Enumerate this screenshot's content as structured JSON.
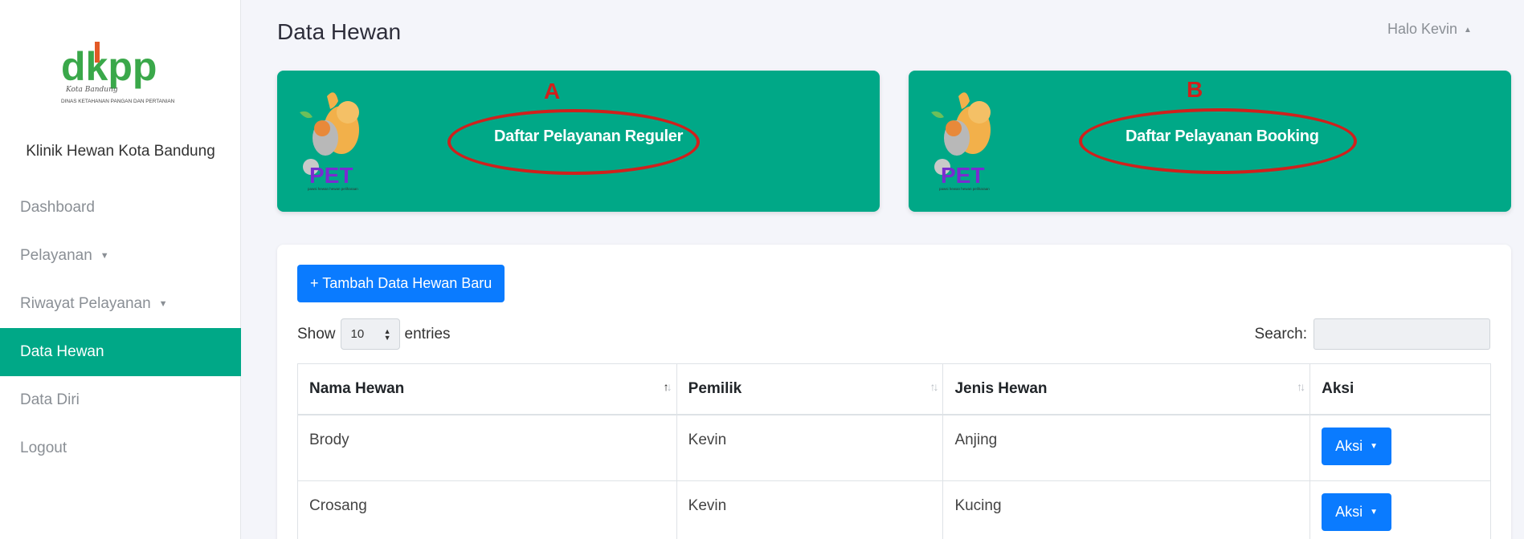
{
  "sidebar": {
    "brand": "Klinik Hewan Kota Bandung",
    "logo_text": "dkpp",
    "logo_sub": "Kota Bandung",
    "logo_caption": "DINAS KETAHANAN PANGAN DAN PERTANIAN",
    "items": [
      {
        "label": "Dashboard",
        "caret": ""
      },
      {
        "label": "Pelayanan",
        "caret": "▼"
      },
      {
        "label": "Riwayat Pelayanan",
        "caret": "▼"
      },
      {
        "label": "Data Hewan",
        "caret": ""
      },
      {
        "label": "Data Diri",
        "caret": ""
      },
      {
        "label": "Logout",
        "caret": ""
      }
    ],
    "active_index": 3
  },
  "header": {
    "title": "Data Hewan",
    "user": "Halo Kevin",
    "user_caret": "▲"
  },
  "banners": [
    {
      "marker": "A",
      "label": "Daftar Pelayanan Reguler",
      "logo_text": "PET",
      "logo_sub": "pawsi hewan hewan peliharaan"
    },
    {
      "marker": "B",
      "label": "Daftar Pelayanan Booking",
      "logo_text": "PET",
      "logo_sub": "pawsi hewan hewan peliharaan"
    }
  ],
  "table_controls": {
    "add_button": "+ Tambah Data Hewan Baru",
    "show_label": "Show",
    "entries_value": "10",
    "entries_label": "entries",
    "search_label": "Search:"
  },
  "table": {
    "columns": [
      "Nama Hewan",
      "Pemilik",
      "Jenis Hewan",
      "Aksi"
    ],
    "rows": [
      {
        "nama": "Brody",
        "pemilik": "Kevin",
        "jenis": "Anjing",
        "aksi": "Aksi"
      },
      {
        "nama": "Crosang",
        "pemilik": "Kevin",
        "jenis": "Kucing",
        "aksi": "Aksi"
      }
    ]
  },
  "colors": {
    "primary_green": "#00a887",
    "button_blue": "#0a7bff",
    "annotation_red": "#d0201c"
  }
}
